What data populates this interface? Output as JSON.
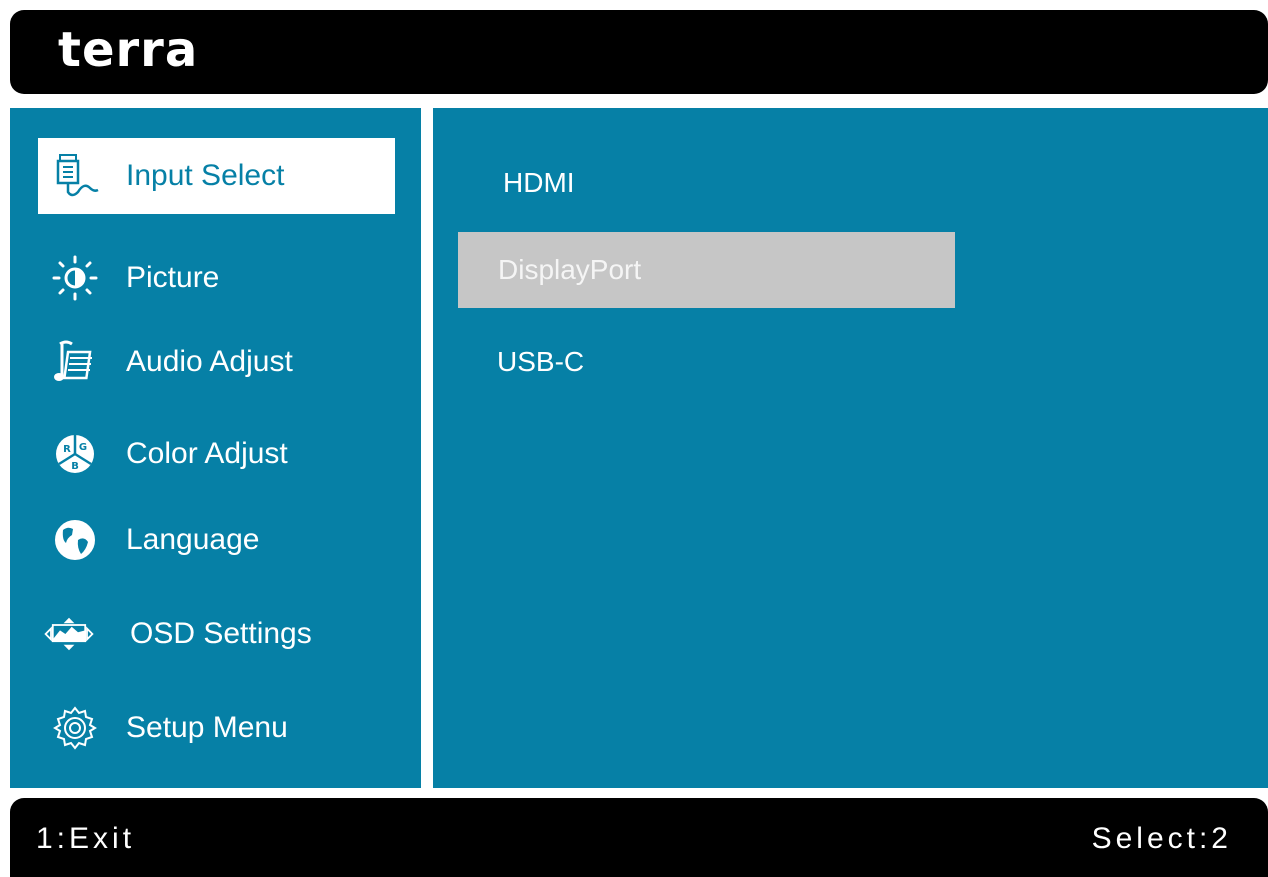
{
  "header": {
    "brand": "terra"
  },
  "sidebar": {
    "items": [
      {
        "label": "Input Select",
        "icon": "input-cable-icon",
        "selected": true
      },
      {
        "label": "Picture",
        "icon": "brightness-icon",
        "selected": false
      },
      {
        "label": "Audio Adjust",
        "icon": "music-notes-icon",
        "selected": false
      },
      {
        "label": "Color Adjust",
        "icon": "rgb-color-icon",
        "selected": false
      },
      {
        "label": "Language",
        "icon": "globe-icon",
        "selected": false
      },
      {
        "label": "OSD Settings",
        "icon": "osd-move-icon",
        "selected": false
      },
      {
        "label": "Setup Menu",
        "icon": "gear-icon",
        "selected": false
      }
    ]
  },
  "content": {
    "options": [
      {
        "label": "HDMI",
        "selected": false
      },
      {
        "label": "DisplayPort",
        "selected": true
      },
      {
        "label": "USB-C",
        "selected": false
      }
    ]
  },
  "footer": {
    "left": "1:Exit",
    "right": "Select:2"
  },
  "colors": {
    "panel": "#0680a6",
    "bar": "#000000",
    "highlight": "#c6c6c6",
    "selected_bg": "#ffffff"
  }
}
